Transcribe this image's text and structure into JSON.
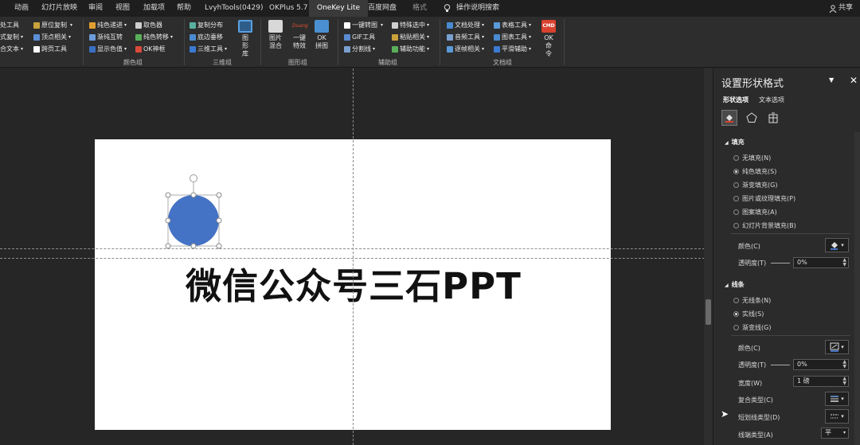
{
  "tabs": [
    "动画",
    "幻灯片放映",
    "审阅",
    "视图",
    "加载项",
    "帮助",
    "LvyhTools(0429)",
    "OKPlus 5.7",
    "OneKey Lite",
    "百度网盘",
    "格式",
    "操作说明搜索"
  ],
  "share_label": "共享",
  "ribbon": {
    "col0": [
      "处工具",
      "式复制",
      "合文本"
    ],
    "col1": [
      "原位复制",
      "顶点相关",
      "跨页工具"
    ],
    "col2": [
      "纯色递进",
      "渐纯互转",
      "显示色值"
    ],
    "col3": [
      "取色器",
      "纯色转移",
      "OK神框"
    ],
    "col4": [
      "复制分布",
      "底边垂移",
      "三维工具"
    ],
    "shape_lib": "图形库",
    "img_mix": "图片混合",
    "one_effect": "一键特效",
    "ok_jigsaw": "OK拼图",
    "col5": [
      "一键转图",
      "GIF工具",
      "分割线"
    ],
    "col6": [
      "特殊选中",
      "粘贴相关",
      "辅助功能"
    ],
    "col7": [
      "文档处理",
      "音频工具",
      "逐帧相关"
    ],
    "col8": [
      "表格工具",
      "图表工具",
      "平滑辅助"
    ],
    "ok_cmd": "OK命令",
    "cmd_badge": "CMD",
    "duang": "Duang",
    "groups": {
      "color": "颜色组",
      "three_d": "三维组",
      "shape": "图形组",
      "assist": "辅助组",
      "doc": "文档组"
    }
  },
  "slide": {
    "title_text": "微信公众号三石PPT",
    "shape_color": "#4472C4"
  },
  "pane": {
    "title": "设置形状格式",
    "tab_shape": "形状选项",
    "tab_text": "文本选项",
    "fill_section": "填充",
    "fill_options": [
      "无填充(N)",
      "纯色填充(S)",
      "渐变填充(G)",
      "图片或纹理填充(P)",
      "图案填充(A)",
      "幻灯片背景填充(B)"
    ],
    "fill_selected": 1,
    "fill_color_label": "颜色(C)",
    "fill_transparency_label": "透明度(T)",
    "fill_transparency_value": "0%",
    "line_section": "线条",
    "line_options": [
      "无线条(N)",
      "实线(S)",
      "渐变线(G)"
    ],
    "line_selected": 1,
    "line_color_label": "颜色(C)",
    "line_transparency_label": "透明度(T)",
    "line_transparency_value": "0%",
    "width_label": "宽度(W)",
    "width_value": "1 磅",
    "compound_label": "复合类型(C)",
    "dash_label": "短划线类型(D)",
    "cap_label": "线端类型(A)",
    "cap_value": "平"
  },
  "colors": {
    "accent_active_tab": "#3a3a3a",
    "shape_fill": "#4472C4",
    "cmd_red": "#d9412f"
  }
}
